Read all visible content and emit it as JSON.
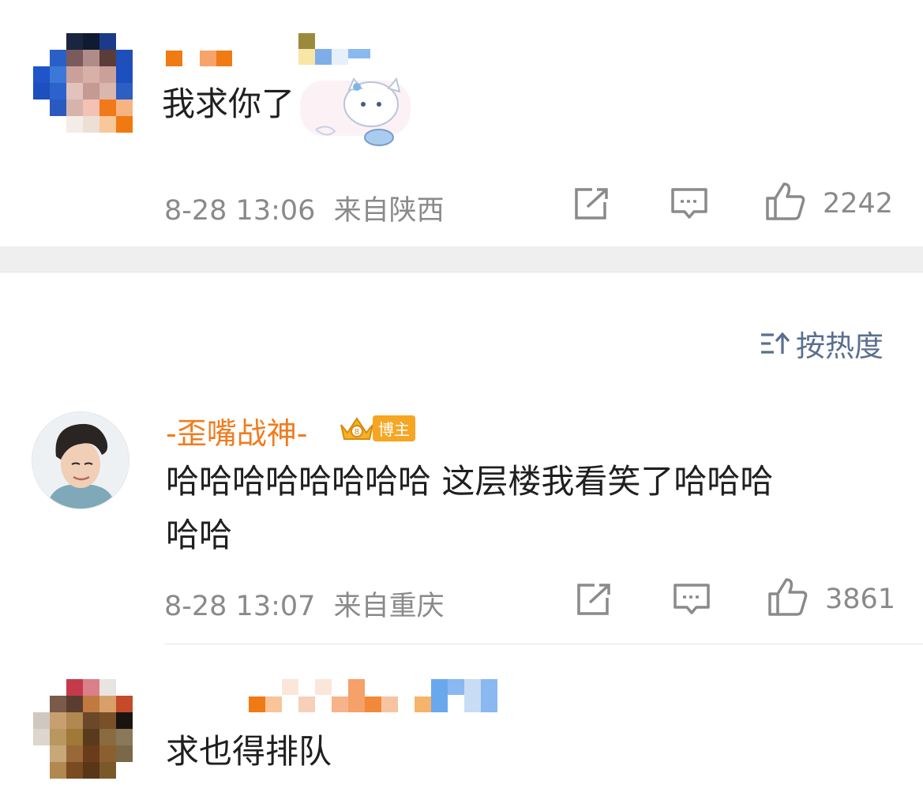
{
  "comments": [
    {
      "text": "我求你了",
      "time": "8-28 13:06",
      "location": "来自陕西",
      "likes": "2242"
    },
    {
      "username": "-歪嘴战神-",
      "badge": "博主",
      "text_line1": "哈哈哈哈哈哈哈哈 这层楼我看笑了哈哈哈",
      "text_line2": "哈哈",
      "time": "8-28 13:07",
      "location": "来自重庆",
      "likes": "3861"
    },
    {
      "text": "求也得排队"
    }
  ],
  "sort": {
    "label": "按热度"
  },
  "icons": {
    "share": "share-icon",
    "comment": "comment-icon",
    "like": "thumbs-up-icon",
    "sort": "sort-icon"
  },
  "colors": {
    "username": "#f07c1e",
    "meta": "#8a8a8a",
    "sort": "#5a6f8e",
    "badge": "#f6a623"
  }
}
